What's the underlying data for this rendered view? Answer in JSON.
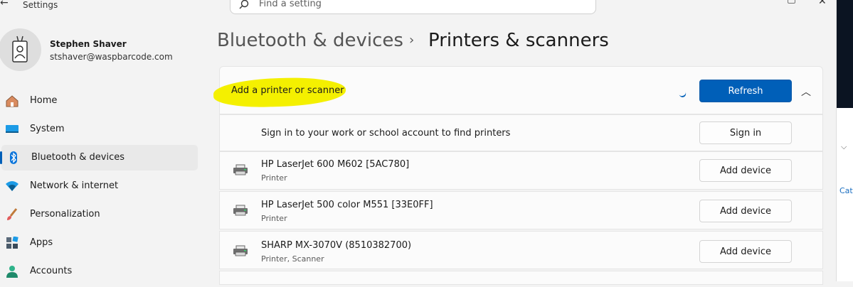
{
  "window": {
    "title": "Settings"
  },
  "search": {
    "placeholder": "Find a setting"
  },
  "user": {
    "name": "Stephen Shaver",
    "email": "stshaver@waspbarcode.com"
  },
  "nav": {
    "items": [
      {
        "label": "Home",
        "icon": "home-icon"
      },
      {
        "label": "System",
        "icon": "monitor-icon"
      },
      {
        "label": "Bluetooth & devices",
        "icon": "bluetooth-icon",
        "selected": true
      },
      {
        "label": "Network & internet",
        "icon": "wifi-icon"
      },
      {
        "label": "Personalization",
        "icon": "brush-icon"
      },
      {
        "label": "Apps",
        "icon": "apps-icon"
      },
      {
        "label": "Accounts",
        "icon": "person-icon"
      }
    ]
  },
  "breadcrumb": {
    "parent": "Bluetooth & devices",
    "separator": "›",
    "current": "Printers & scanners"
  },
  "add_section": {
    "title": "Add a printer or scanner",
    "refresh_label": "Refresh"
  },
  "signin": {
    "text": "Sign in to your work or school account to find printers",
    "button_label": "Sign in"
  },
  "printers": [
    {
      "name": "HP LaserJet 600 M602 [5AC780]",
      "type": "Printer",
      "button_label": "Add device"
    },
    {
      "name": "HP LaserJet 500 color M551 [33E0FF]",
      "type": "Printer",
      "button_label": "Add device"
    },
    {
      "name": "SHARP MX-3070V (8510382700)",
      "type": "Printer, Scanner",
      "button_label": "Add device"
    }
  ],
  "right_strip": {
    "text": "Cate"
  },
  "colors": {
    "accent": "#005fb8",
    "highlight": "#f4f000"
  }
}
